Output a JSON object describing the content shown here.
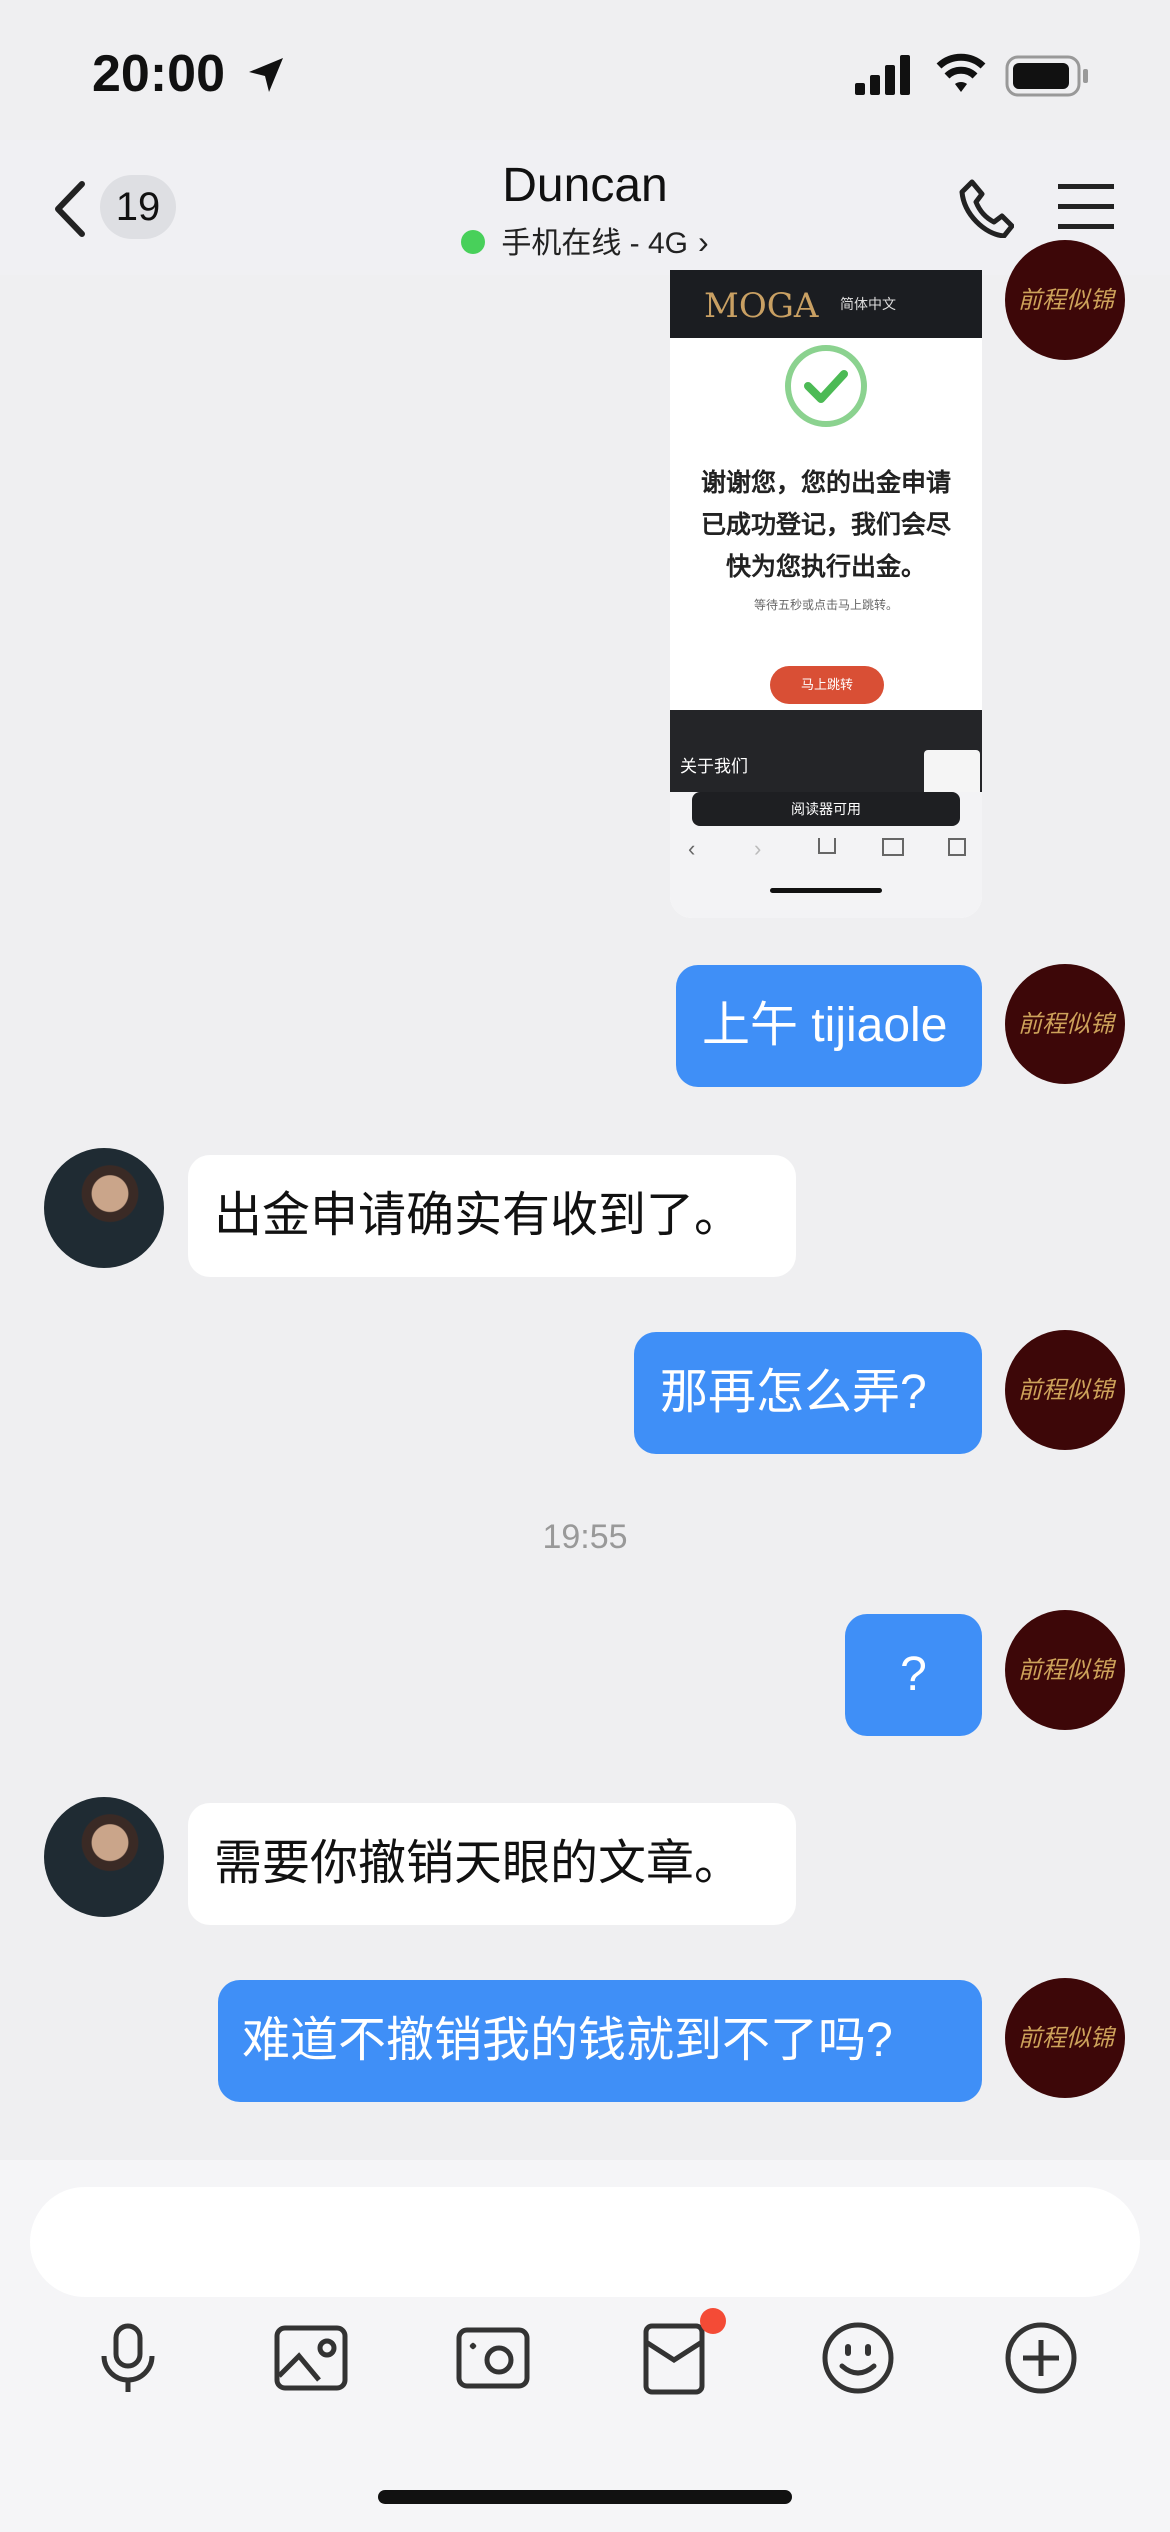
{
  "status_bar": {
    "time": "20:00"
  },
  "header": {
    "back_count": "19",
    "title": "Duncan",
    "subtitle": "手机在线 - 4G"
  },
  "avatar_me_text": "前程似锦",
  "shared_screenshot": {
    "logo": "MOGA",
    "language": "简体中文",
    "message": [
      "谢谢您，您的出金申请",
      "已成功登记，我们会尽",
      "快为您执行出金。"
    ],
    "sub_text": "等待五秒或点击马上跳转。",
    "redirect_button": "马上跳转",
    "footer_title": "关于我们",
    "reader_bar": "阅读器可用"
  },
  "messages": [
    {
      "side": "me",
      "text": "上午 tijiaole"
    },
    {
      "side": "them",
      "text": "出金申请确实有收到了。"
    },
    {
      "side": "me",
      "text": "那再怎么弄?"
    },
    {
      "side": "me",
      "text": "?"
    },
    {
      "side": "them",
      "text": "需要你撤销天眼的文章。"
    },
    {
      "side": "me",
      "text": "难道不撤销我的钱就到不了吗?"
    }
  ],
  "timestamp": "19:55",
  "colors": {
    "bubble_me": "#3f8ff7",
    "bubble_them": "#ffffff",
    "online": "#48d05a",
    "badge": "#f44b36"
  },
  "toolbar_icons": [
    "microphone-icon",
    "image-icon",
    "camera-icon",
    "red-packet-icon",
    "emoji-icon",
    "plus-icon"
  ]
}
